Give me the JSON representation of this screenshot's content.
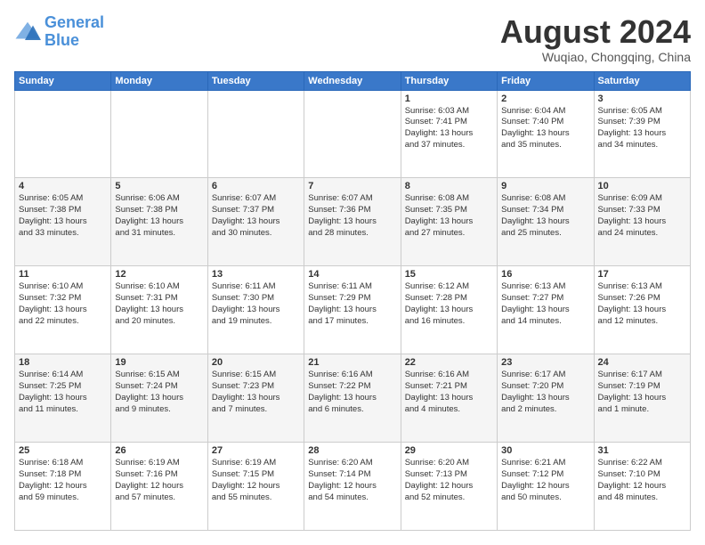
{
  "logo": {
    "line1": "General",
    "line2": "Blue"
  },
  "title": "August 2024",
  "location": "Wuqiao, Chongqing, China",
  "days_header": [
    "Sunday",
    "Monday",
    "Tuesday",
    "Wednesday",
    "Thursday",
    "Friday",
    "Saturday"
  ],
  "weeks": [
    [
      {
        "day": "",
        "info": ""
      },
      {
        "day": "",
        "info": ""
      },
      {
        "day": "",
        "info": ""
      },
      {
        "day": "",
        "info": ""
      },
      {
        "day": "1",
        "info": "Sunrise: 6:03 AM\nSunset: 7:41 PM\nDaylight: 13 hours\nand 37 minutes."
      },
      {
        "day": "2",
        "info": "Sunrise: 6:04 AM\nSunset: 7:40 PM\nDaylight: 13 hours\nand 35 minutes."
      },
      {
        "day": "3",
        "info": "Sunrise: 6:05 AM\nSunset: 7:39 PM\nDaylight: 13 hours\nand 34 minutes."
      }
    ],
    [
      {
        "day": "4",
        "info": "Sunrise: 6:05 AM\nSunset: 7:38 PM\nDaylight: 13 hours\nand 33 minutes."
      },
      {
        "day": "5",
        "info": "Sunrise: 6:06 AM\nSunset: 7:38 PM\nDaylight: 13 hours\nand 31 minutes."
      },
      {
        "day": "6",
        "info": "Sunrise: 6:07 AM\nSunset: 7:37 PM\nDaylight: 13 hours\nand 30 minutes."
      },
      {
        "day": "7",
        "info": "Sunrise: 6:07 AM\nSunset: 7:36 PM\nDaylight: 13 hours\nand 28 minutes."
      },
      {
        "day": "8",
        "info": "Sunrise: 6:08 AM\nSunset: 7:35 PM\nDaylight: 13 hours\nand 27 minutes."
      },
      {
        "day": "9",
        "info": "Sunrise: 6:08 AM\nSunset: 7:34 PM\nDaylight: 13 hours\nand 25 minutes."
      },
      {
        "day": "10",
        "info": "Sunrise: 6:09 AM\nSunset: 7:33 PM\nDaylight: 13 hours\nand 24 minutes."
      }
    ],
    [
      {
        "day": "11",
        "info": "Sunrise: 6:10 AM\nSunset: 7:32 PM\nDaylight: 13 hours\nand 22 minutes."
      },
      {
        "day": "12",
        "info": "Sunrise: 6:10 AM\nSunset: 7:31 PM\nDaylight: 13 hours\nand 20 minutes."
      },
      {
        "day": "13",
        "info": "Sunrise: 6:11 AM\nSunset: 7:30 PM\nDaylight: 13 hours\nand 19 minutes."
      },
      {
        "day": "14",
        "info": "Sunrise: 6:11 AM\nSunset: 7:29 PM\nDaylight: 13 hours\nand 17 minutes."
      },
      {
        "day": "15",
        "info": "Sunrise: 6:12 AM\nSunset: 7:28 PM\nDaylight: 13 hours\nand 16 minutes."
      },
      {
        "day": "16",
        "info": "Sunrise: 6:13 AM\nSunset: 7:27 PM\nDaylight: 13 hours\nand 14 minutes."
      },
      {
        "day": "17",
        "info": "Sunrise: 6:13 AM\nSunset: 7:26 PM\nDaylight: 13 hours\nand 12 minutes."
      }
    ],
    [
      {
        "day": "18",
        "info": "Sunrise: 6:14 AM\nSunset: 7:25 PM\nDaylight: 13 hours\nand 11 minutes."
      },
      {
        "day": "19",
        "info": "Sunrise: 6:15 AM\nSunset: 7:24 PM\nDaylight: 13 hours\nand 9 minutes."
      },
      {
        "day": "20",
        "info": "Sunrise: 6:15 AM\nSunset: 7:23 PM\nDaylight: 13 hours\nand 7 minutes."
      },
      {
        "day": "21",
        "info": "Sunrise: 6:16 AM\nSunset: 7:22 PM\nDaylight: 13 hours\nand 6 minutes."
      },
      {
        "day": "22",
        "info": "Sunrise: 6:16 AM\nSunset: 7:21 PM\nDaylight: 13 hours\nand 4 minutes."
      },
      {
        "day": "23",
        "info": "Sunrise: 6:17 AM\nSunset: 7:20 PM\nDaylight: 13 hours\nand 2 minutes."
      },
      {
        "day": "24",
        "info": "Sunrise: 6:17 AM\nSunset: 7:19 PM\nDaylight: 13 hours\nand 1 minute."
      }
    ],
    [
      {
        "day": "25",
        "info": "Sunrise: 6:18 AM\nSunset: 7:18 PM\nDaylight: 12 hours\nand 59 minutes."
      },
      {
        "day": "26",
        "info": "Sunrise: 6:19 AM\nSunset: 7:16 PM\nDaylight: 12 hours\nand 57 minutes."
      },
      {
        "day": "27",
        "info": "Sunrise: 6:19 AM\nSunset: 7:15 PM\nDaylight: 12 hours\nand 55 minutes."
      },
      {
        "day": "28",
        "info": "Sunrise: 6:20 AM\nSunset: 7:14 PM\nDaylight: 12 hours\nand 54 minutes."
      },
      {
        "day": "29",
        "info": "Sunrise: 6:20 AM\nSunset: 7:13 PM\nDaylight: 12 hours\nand 52 minutes."
      },
      {
        "day": "30",
        "info": "Sunrise: 6:21 AM\nSunset: 7:12 PM\nDaylight: 12 hours\nand 50 minutes."
      },
      {
        "day": "31",
        "info": "Sunrise: 6:22 AM\nSunset: 7:10 PM\nDaylight: 12 hours\nand 48 minutes."
      }
    ]
  ]
}
